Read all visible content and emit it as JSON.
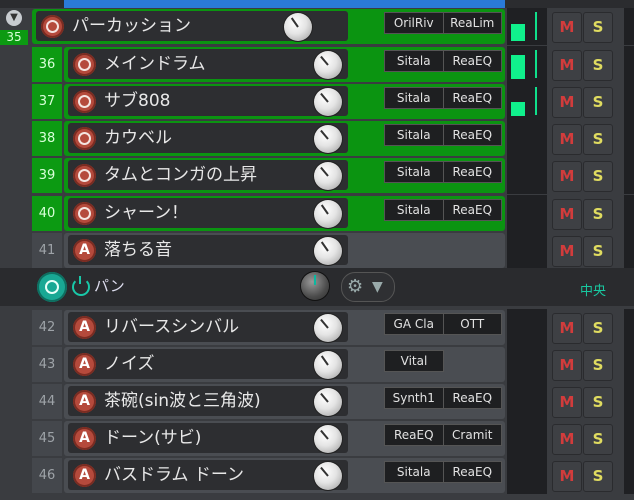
{
  "colors": {
    "green_track": "#0b9411",
    "mute": "#d23c3c",
    "solo": "#e0dc60",
    "accent_teal": "#19a894",
    "meter_green": "#10f08c"
  },
  "buttons": {
    "mute": "M",
    "solo": "S"
  },
  "tracks": [
    {
      "num": "35",
      "name": "パーカッション",
      "icon": "ring",
      "fx": [
        "OrilRiv",
        "ReaLim"
      ],
      "folder": true
    },
    {
      "num": "36",
      "name": "メインドラム",
      "icon": "ring",
      "fx": [
        "Sitala",
        "ReaEQ"
      ]
    },
    {
      "num": "37",
      "name": "サブ808",
      "icon": "ring",
      "fx": [
        "Sitala",
        "ReaEQ"
      ]
    },
    {
      "num": "38",
      "name": "カウベル",
      "icon": "ring",
      "fx": [
        "Sitala",
        "ReaEQ"
      ]
    },
    {
      "num": "39",
      "name": "タムとコンガの上昇",
      "icon": "ring",
      "fx": [
        "Sitala",
        "ReaEQ"
      ]
    },
    {
      "num": "40",
      "name": "シャーン！",
      "icon": "ring",
      "fx": [
        "Sitala",
        "ReaEQ"
      ]
    },
    {
      "num": "41",
      "name": "落ちる音",
      "icon": "letter",
      "icon_text": "A",
      "fx": []
    },
    {
      "num": "42",
      "name": "リバースシンバル",
      "icon": "letter",
      "icon_text": "A",
      "fx": [
        "GA Cla",
        "OTT"
      ]
    },
    {
      "num": "43",
      "name": "ノイズ",
      "icon": "letter",
      "icon_text": "A",
      "fx": [
        "Vital"
      ]
    },
    {
      "num": "44",
      "name": "茶碗(sin波と三角波)",
      "icon": "letter",
      "icon_text": "A",
      "fx": [
        "Synth1",
        "ReaEQ"
      ]
    },
    {
      "num": "45",
      "name": "ドーン(サビ)",
      "icon": "letter",
      "icon_text": "A",
      "fx": [
        "ReaEQ",
        "Cramit"
      ]
    },
    {
      "num": "46",
      "name": "バスドラム ドーン",
      "icon": "letter",
      "icon_text": "A",
      "fx": [
        "Sitala",
        "ReaEQ"
      ]
    }
  ],
  "pan": {
    "label": "パン",
    "value_label": "中央"
  },
  "meters": [
    {
      "level": 0.55
    },
    {
      "level": 0.8
    },
    {
      "level": 0.45
    },
    {
      "level": 0
    },
    {
      "level": 0
    },
    {
      "level": 0
    }
  ]
}
